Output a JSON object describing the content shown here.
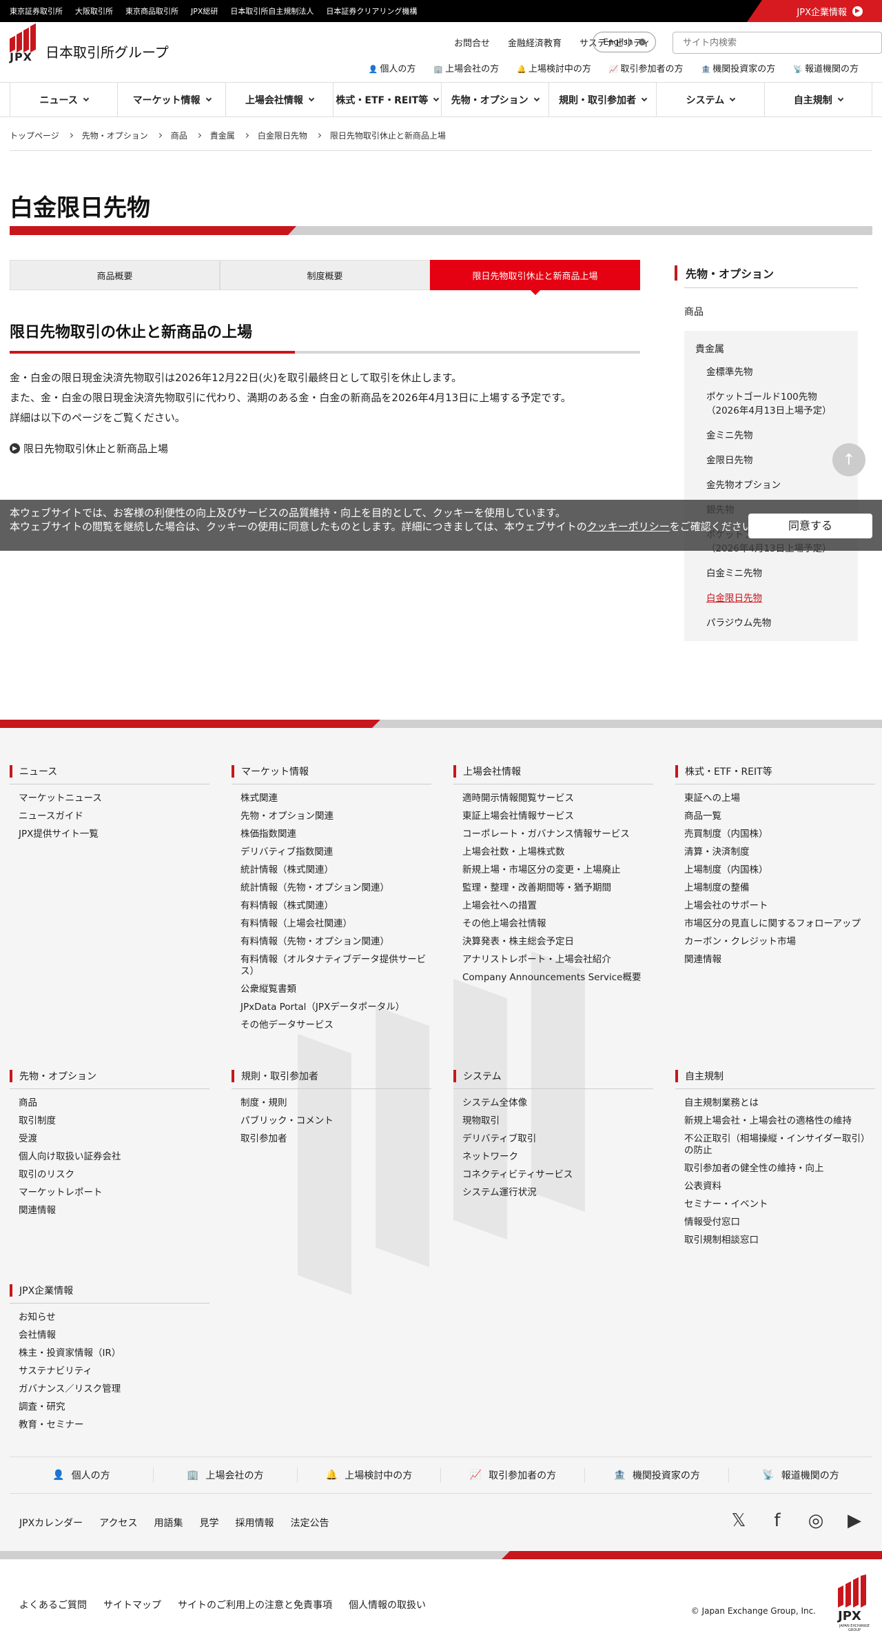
{
  "topbar": {
    "links": [
      "東京証券取引所",
      "大阪取引所",
      "東京商品取引所",
      "JPX総研",
      "日本取引所自主規制法人",
      "日本証券クリアリング機構"
    ],
    "corp_label": "JPX企業情報"
  },
  "header": {
    "logo_text": "JPX",
    "logo_name": "日本取引所グループ",
    "util_links": [
      "お問合せ",
      "金融経済教育",
      "サステナビリティ"
    ],
    "english_label": "English",
    "search_placeholder": "サイト内検索",
    "persona": [
      {
        "icon": "person-icon",
        "glyph": "👤",
        "label": "個人の方"
      },
      {
        "icon": "building-icon",
        "glyph": "🏢",
        "label": "上場会社の方"
      },
      {
        "icon": "bell-icon",
        "glyph": "🔔",
        "label": "上場検討中の方"
      },
      {
        "icon": "chart-icon",
        "glyph": "📈",
        "label": "取引参加者の方"
      },
      {
        "icon": "institution-icon",
        "glyph": "🏦",
        "label": "機関投資家の方"
      },
      {
        "icon": "broadcast-icon",
        "glyph": "📡",
        "label": "報道機関の方"
      }
    ]
  },
  "gnav": [
    "ニュース",
    "マーケット情報",
    "上場会社情報",
    "株式・ETF・REIT等",
    "先物・オプション",
    "規則・取引参加者",
    "システム",
    "自主規制"
  ],
  "breadcrumb": [
    "トップページ",
    "先物・オプション",
    "商品",
    "貴金属",
    "白金限日先物",
    "限日先物取引休止と新商品上場"
  ],
  "page_title": "白金限日先物",
  "tabs": [
    {
      "label": "商品概要",
      "active": false
    },
    {
      "label": "制度概要",
      "active": false
    },
    {
      "label": "限日先物取引休止と新商品上場",
      "active": true
    }
  ],
  "section_title": "限日先物取引の休止と新商品の上場",
  "body": [
    "金・白金の限日現金決済先物取引は2026年12月22日(火)を取引最終日として取引を休止します。",
    "また、金・白金の限日現金決済先物取引に代わり、満期のある金・白金の新商品を2026年4月13日に上場する予定です。",
    "詳細は以下のページをご覧ください。"
  ],
  "body_link": "限日先物取引休止と新商品上場",
  "sidebar": {
    "heading": "先物・オプション",
    "product": "商品",
    "category": "貴金属",
    "items": [
      {
        "label": "金標準先物",
        "current": false
      },
      {
        "label": "ポケットゴールド100先物（2026年4月13日上場予定）",
        "current": false
      },
      {
        "label": "金ミニ先物",
        "current": false
      },
      {
        "label": "金限日先物",
        "current": false
      },
      {
        "label": "金先物オプション",
        "current": false
      },
      {
        "label": "銀先物",
        "current": false
      },
      {
        "label": "ポケットプラチナ100先物（2026年4月13日上場予定）",
        "current": false
      },
      {
        "label": "白金ミニ先物",
        "current": false
      },
      {
        "label": "白金限日先物",
        "current": true
      },
      {
        "label": "パラジウム先物",
        "current": false
      }
    ]
  },
  "cookie": {
    "text1": "本ウェブサイトでは、お客様の利便性の向上及びサービスの品質維持・向上を目的として、クッキーを使用しています。",
    "text2": "本ウェブサイトの閲覧を継続した場合は、クッキーの使用に同意したものとします。詳細につきましては、本ウェブサイトの",
    "link": "クッキーポリシー",
    "text3": "をご確認ください。",
    "agree": "同意する"
  },
  "footer": {
    "columns": [
      {
        "title": "ニュース",
        "items": [
          "マーケットニュース",
          "ニュースガイド",
          "JPX提供サイト一覧"
        ]
      },
      {
        "title": "マーケット情報",
        "items": [
          "株式関連",
          "先物・オプション関連",
          "株価指数関連",
          "デリバティブ指数関連",
          "統計情報（株式関連）",
          "統計情報（先物・オプション関連）",
          "有料情報（株式関連）",
          "有料情報（上場会社関連）",
          "有料情報（先物・オプション関連）",
          "有料情報（オルタナティブデータ提供サービス）",
          "公衆縦覧書類",
          "JPxData Portal（JPXデータポータル）",
          "その他データサービス"
        ]
      },
      {
        "title": "上場会社情報",
        "items": [
          "適時開示情報閲覧サービス",
          "東証上場会社情報サービス",
          "コーポレート・ガバナンス情報サービス",
          "上場会社数・上場株式数",
          "新規上場・市場区分の変更・上場廃止",
          "監理・整理・改善期間等・猶予期間",
          "上場会社への措置",
          "その他上場会社情報",
          "決算発表・株主総会予定日",
          "アナリストレポート・上場会社紹介",
          "Company Announcements Service概要"
        ]
      },
      {
        "title": "株式・ETF・REIT等",
        "items": [
          "東証への上場",
          "商品一覧",
          "売買制度（内国株）",
          "清算・決済制度",
          "上場制度（内国株）",
          "上場制度の整備",
          "上場会社のサポート",
          "市場区分の見直しに関するフォローアップ",
          "カーボン・クレジット市場",
          "関連情報"
        ]
      },
      {
        "title": "先物・オプション",
        "items": [
          "商品",
          "取引制度",
          "受渡",
          "個人向け取扱い証券会社",
          "取引のリスク",
          "マーケットレポート",
          "関連情報"
        ]
      },
      {
        "title": "規則・取引参加者",
        "items": [
          "制度・規則",
          "パブリック・コメント",
          "取引参加者"
        ]
      },
      {
        "title": "システム",
        "items": [
          "システム全体像",
          "現物取引",
          "デリバティブ取引",
          "ネットワーク",
          "コネクティビティサービス",
          "システム運行状況"
        ]
      },
      {
        "title": "自主規制",
        "items": [
          "自主規制業務とは",
          "新規上場会社・上場会社の適格性の維持",
          "不公正取引（相場操縦・インサイダー取引）の防止",
          "取引参加者の健全性の維持・向上",
          "公表資料",
          "セミナー・イベント",
          "情報受付窓口",
          "取引規制相談窓口"
        ]
      },
      {
        "title": "JPX企業情報",
        "items": [
          "お知らせ",
          "会社情報",
          "株主・投資家情報（IR）",
          "サステナビリティ",
          "ガバナンス／リスク管理",
          "調査・研究",
          "教育・セミナー"
        ]
      }
    ],
    "persona": [
      {
        "icon": "person-icon",
        "glyph": "👤",
        "label": "個人の方"
      },
      {
        "icon": "building-icon",
        "glyph": "🏢",
        "label": "上場会社の方"
      },
      {
        "icon": "bell-icon",
        "glyph": "🔔",
        "label": "上場検討中の方"
      },
      {
        "icon": "chart-icon",
        "glyph": "📈",
        "label": "取引参加者の方"
      },
      {
        "icon": "institution-icon",
        "glyph": "🏦",
        "label": "機関投資家の方"
      },
      {
        "icon": "broadcast-icon",
        "glyph": "📡",
        "label": "報道機関の方"
      }
    ],
    "links": [
      "JPXカレンダー",
      "アクセス",
      "用語集",
      "見学",
      "採用情報",
      "法定公告"
    ],
    "social": [
      {
        "icon": "x-icon",
        "glyph": "𝕏"
      },
      {
        "icon": "facebook-icon",
        "glyph": "f"
      },
      {
        "icon": "instagram-icon",
        "glyph": "◎"
      },
      {
        "icon": "youtube-icon",
        "glyph": "▶"
      }
    ],
    "bottom_links": [
      "よくあるご質問",
      "サイトマップ",
      "サイトのご利用上の注意と免責事項",
      "個人情報の取扱い"
    ],
    "copyright": "© Japan Exchange Group, Inc.",
    "logo_text": "JPX",
    "logo_sub": "JAPAN EXCHANGE GROUP"
  },
  "colors": {
    "brand_red": "#c8161d",
    "tab_red": "#e50012",
    "footer_bg": "#f5f5f5"
  }
}
